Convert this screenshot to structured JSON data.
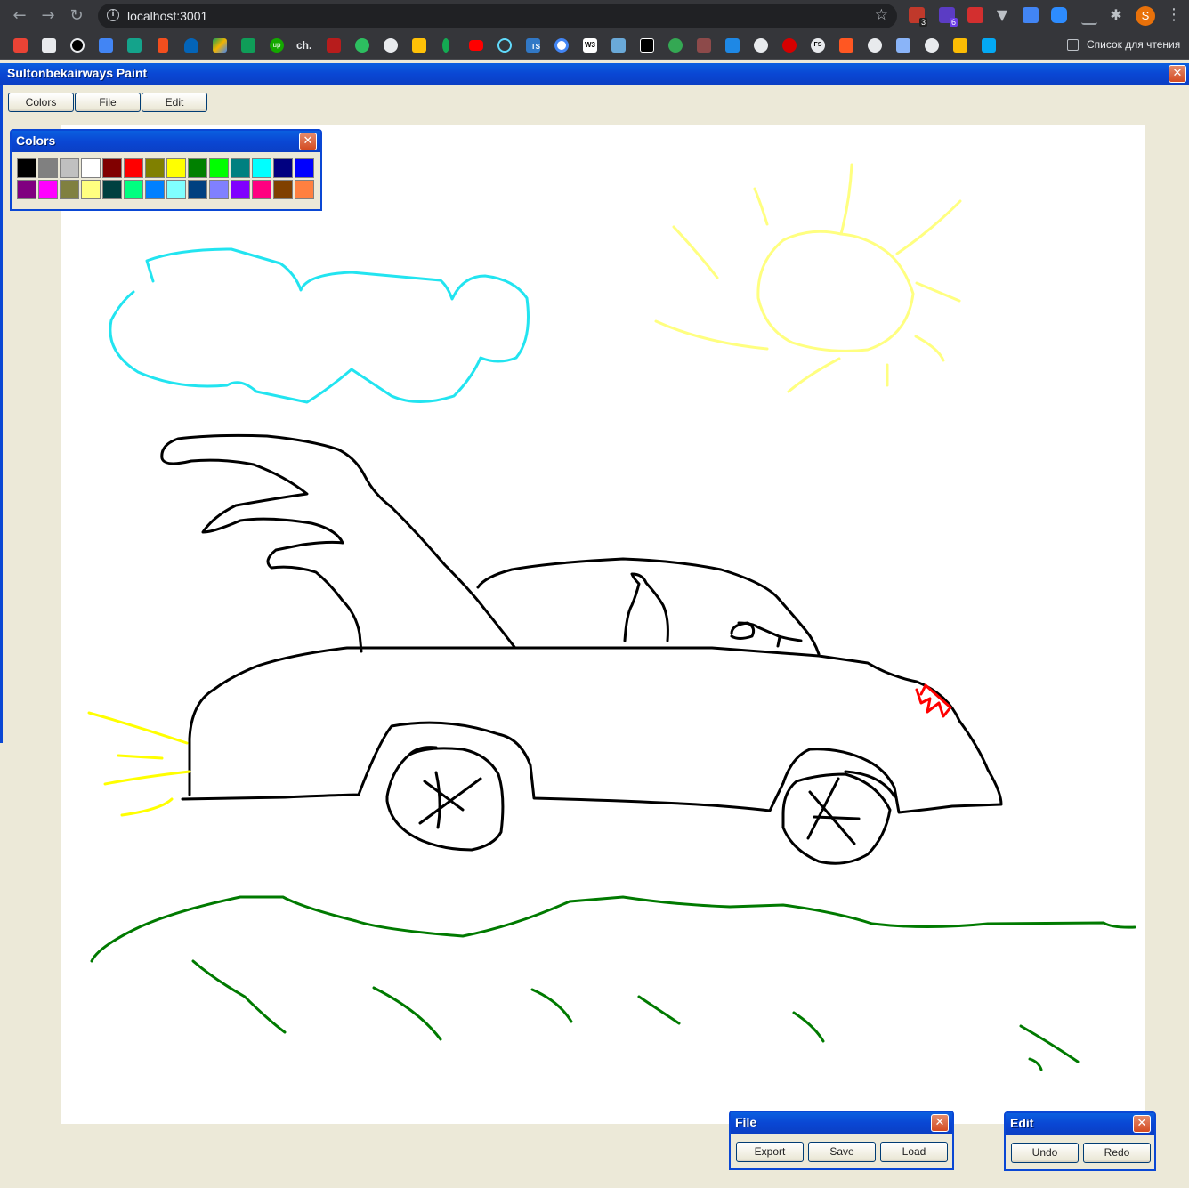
{
  "browser": {
    "url": "localhost:3001",
    "reading_list_label": "Список для чтения",
    "profile_initial": "S",
    "extension_badges": [
      "3",
      "6"
    ],
    "bookmark_labels": [
      "up",
      "ch.",
      "TS",
      "W3",
      "FS"
    ]
  },
  "app": {
    "title": "Sultonbekairways Paint",
    "menu": {
      "colors": "Colors",
      "file": "File",
      "edit": "Edit"
    }
  },
  "colors_panel": {
    "title": "Colors",
    "palette": [
      "#000000",
      "#808080",
      "#c0c0c0",
      "#ffffff",
      "#800000",
      "#ff0000",
      "#808000",
      "#ffff00",
      "#008000",
      "#00ff00",
      "#008080",
      "#00ffff",
      "#000080",
      "#0000ff",
      "#800080",
      "#ff00ff",
      "#808040",
      "#ffff80",
      "#004040",
      "#00ff80",
      "#0080ff",
      "#80ffff",
      "#004080",
      "#8080ff",
      "#8000ff",
      "#ff0080",
      "#804000",
      "#ff8040"
    ]
  },
  "file_panel": {
    "title": "File",
    "export": "Export",
    "save": "Save",
    "load": "Load"
  },
  "edit_panel": {
    "title": "Edit",
    "undo": "Undo",
    "redo": "Redo"
  },
  "stroke_colors": {
    "cloud": "#22e4f0",
    "sun": "#ffff80",
    "car": "#000000",
    "ground": "#007a00",
    "headlight": "#ffff00",
    "taillight": "#ff0000"
  }
}
